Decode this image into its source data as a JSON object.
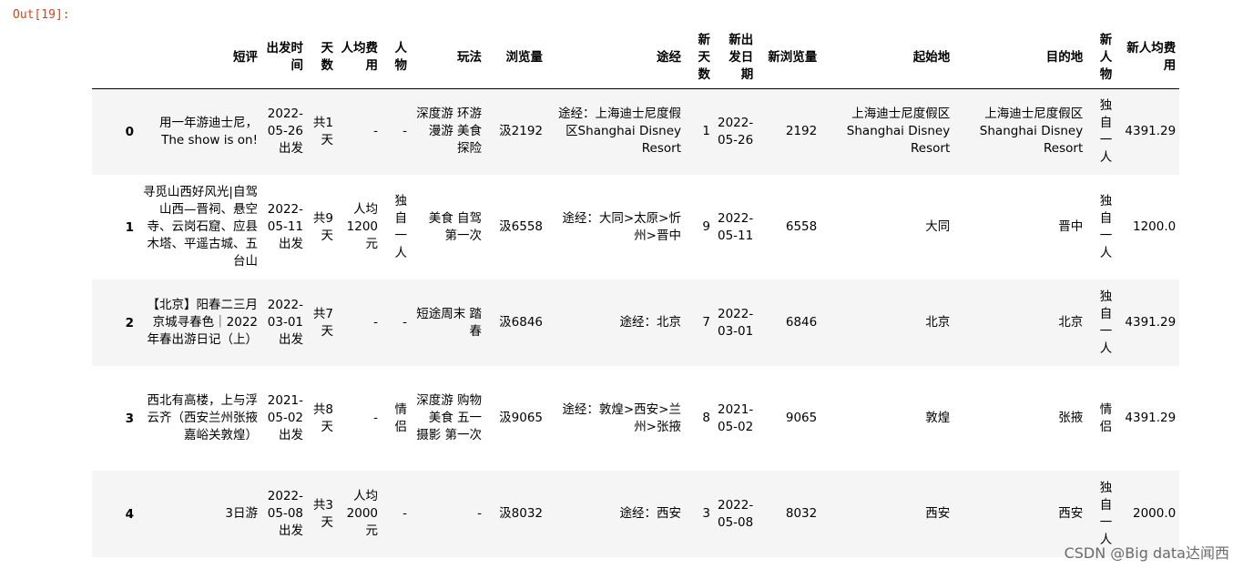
{
  "cell": {
    "prompt": "Out[19]:"
  },
  "table": {
    "columns": [
      "短评",
      "出发时间",
      "天数",
      "人均费用",
      "人物",
      "玩法",
      "浏览量",
      "途经",
      "新天数",
      "新出发日期",
      "新浏览量",
      "起始地",
      "目的地",
      "新人物",
      "新人均费用"
    ],
    "rows": [
      {
        "index": "0",
        "cells": [
          "用一年游迪士尼，The show is on!",
          "2022-05-26出发",
          "共1天",
          "-",
          "-",
          "深度游 环游 漫游 美食 探险",
          "汲2192",
          "途经：上海迪士尼度假区Shanghai Disney Resort",
          "1",
          "2022-05-26",
          "2192",
          "上海迪士尼度假区Shanghai Disney Resort",
          "上海迪士尼度假区Shanghai Disney Resort",
          "独自一人",
          "4391.29"
        ]
      },
      {
        "index": "1",
        "cells": [
          "寻觅山西好风光|自驾山西—晋祠、悬空寺、云岗石窟、应县木塔、平遥古城、五台山",
          "2022-05-11出发",
          "共9天",
          "人均1200元",
          "独自一人",
          "美食 自驾 第一次",
          "汲6558",
          "途经：大同>太原>忻州>晋中",
          "9",
          "2022-05-11",
          "6558",
          "大同",
          "晋中",
          "独自一人",
          "1200.0"
        ]
      },
      {
        "index": "2",
        "cells": [
          "【北京】阳春二三月 京城寻春色｜2022年春出游日记（上）",
          "2022-03-01出发",
          "共7天",
          "-",
          "-",
          "短途周末 踏春",
          "汲6846",
          "途经：北京",
          "7",
          "2022-03-01",
          "6846",
          "北京",
          "北京",
          "独自一人",
          "4391.29"
        ]
      },
      {
        "index": "3",
        "cells": [
          "西北有高楼，上与浮云齐（西安兰州张掖嘉峪关敦煌）",
          "2021-05-02出发",
          "共8天",
          "-",
          "情侣",
          "深度游 购物 美食 五一 摄影 第一次",
          "汲9065",
          "途经：敦煌>西安>兰州>张掖",
          "8",
          "2021-05-02",
          "9065",
          "敦煌",
          "张掖",
          "情侣",
          "4391.29"
        ]
      },
      {
        "index": "4",
        "cells": [
          "3日游",
          "2022-05-08出发",
          "共3天",
          "人均2000元",
          "-",
          "-",
          "汲8032",
          "途经：西安",
          "3",
          "2022-05-08",
          "8032",
          "西安",
          "西安",
          "独自一人",
          "2000.0"
        ]
      }
    ]
  },
  "watermark": "CSDN @Big data达闻西"
}
